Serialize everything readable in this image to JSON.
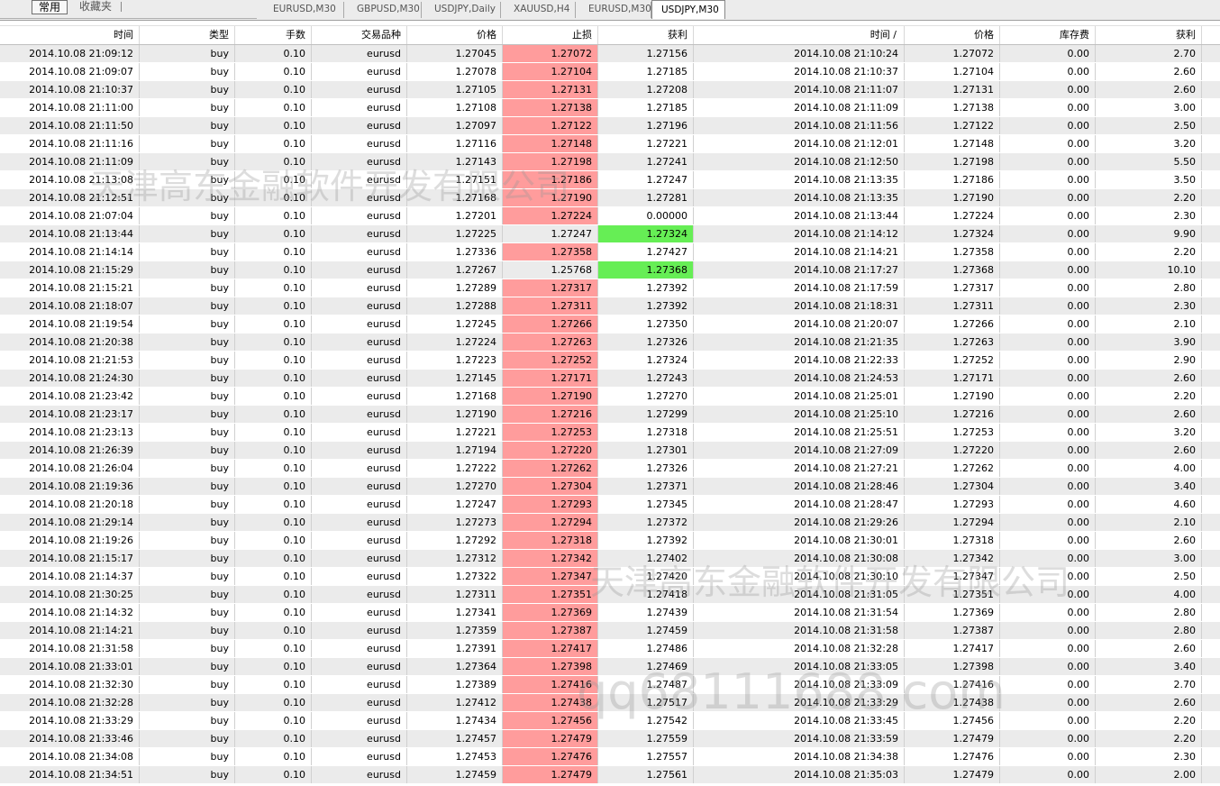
{
  "toolbar": {
    "common_label": "常用",
    "favorites_label": "收藏夹"
  },
  "tabs": [
    "EURUSD,M30",
    "GBPUSD,M30",
    "USDJPY,Daily",
    "XAUUSD,H4",
    "EURUSD,M30",
    "USDJPY,M30"
  ],
  "active_tab": 5,
  "columns": [
    "时间",
    "类型",
    "手数",
    "交易品种",
    "价格",
    "止损",
    "获利",
    "时间 /",
    "价格",
    "库存费",
    "获利"
  ],
  "colors": {
    "sl_highlight": "#ff9c9c",
    "tp_highlight": "#66ee55",
    "alt_row": "#ebebeb"
  },
  "rows": [
    [
      "2014.10.08 21:09:12",
      "buy",
      "0.10",
      "eurusd",
      "1.27045",
      "1.27072",
      "1.27156",
      "2014.10.08 21:10:24",
      "1.27072",
      "0.00",
      "2.70",
      "sl"
    ],
    [
      "2014.10.08 21:09:07",
      "buy",
      "0.10",
      "eurusd",
      "1.27078",
      "1.27104",
      "1.27185",
      "2014.10.08 21:10:37",
      "1.27104",
      "0.00",
      "2.60",
      "sl"
    ],
    [
      "2014.10.08 21:10:37",
      "buy",
      "0.10",
      "eurusd",
      "1.27105",
      "1.27131",
      "1.27208",
      "2014.10.08 21:11:07",
      "1.27131",
      "0.00",
      "2.60",
      "sl"
    ],
    [
      "2014.10.08 21:11:00",
      "buy",
      "0.10",
      "eurusd",
      "1.27108",
      "1.27138",
      "1.27185",
      "2014.10.08 21:11:09",
      "1.27138",
      "0.00",
      "3.00",
      "sl"
    ],
    [
      "2014.10.08 21:11:50",
      "buy",
      "0.10",
      "eurusd",
      "1.27097",
      "1.27122",
      "1.27196",
      "2014.10.08 21:11:56",
      "1.27122",
      "0.00",
      "2.50",
      "sl"
    ],
    [
      "2014.10.08 21:11:16",
      "buy",
      "0.10",
      "eurusd",
      "1.27116",
      "1.27148",
      "1.27221",
      "2014.10.08 21:12:01",
      "1.27148",
      "0.00",
      "3.20",
      "sl"
    ],
    [
      "2014.10.08 21:11:09",
      "buy",
      "0.10",
      "eurusd",
      "1.27143",
      "1.27198",
      "1.27241",
      "2014.10.08 21:12:50",
      "1.27198",
      "0.00",
      "5.50",
      "sl"
    ],
    [
      "2014.10.08 21:13:08",
      "buy",
      "0.10",
      "eurusd",
      "1.27151",
      "1.27186",
      "1.27247",
      "2014.10.08 21:13:35",
      "1.27186",
      "0.00",
      "3.50",
      "sl"
    ],
    [
      "2014.10.08 21:12:51",
      "buy",
      "0.10",
      "eurusd",
      "1.27168",
      "1.27190",
      "1.27281",
      "2014.10.08 21:13:35",
      "1.27190",
      "0.00",
      "2.20",
      "sl"
    ],
    [
      "2014.10.08 21:07:04",
      "buy",
      "0.10",
      "eurusd",
      "1.27201",
      "1.27224",
      "0.00000",
      "2014.10.08 21:13:44",
      "1.27224",
      "0.00",
      "2.30",
      "sl"
    ],
    [
      "2014.10.08 21:13:44",
      "buy",
      "0.10",
      "eurusd",
      "1.27225",
      "1.27247",
      "1.27324",
      "2014.10.08 21:14:12",
      "1.27324",
      "0.00",
      "9.90",
      "tp"
    ],
    [
      "2014.10.08 21:14:14",
      "buy",
      "0.10",
      "eurusd",
      "1.27336",
      "1.27358",
      "1.27427",
      "2014.10.08 21:14:21",
      "1.27358",
      "0.00",
      "2.20",
      "sl"
    ],
    [
      "2014.10.08 21:15:29",
      "buy",
      "0.10",
      "eurusd",
      "1.27267",
      "1.25768",
      "1.27368",
      "2014.10.08 21:17:27",
      "1.27368",
      "0.00",
      "10.10",
      "tp"
    ],
    [
      "2014.10.08 21:15:21",
      "buy",
      "0.10",
      "eurusd",
      "1.27289",
      "1.27317",
      "1.27392",
      "2014.10.08 21:17:59",
      "1.27317",
      "0.00",
      "2.80",
      "sl"
    ],
    [
      "2014.10.08 21:18:07",
      "buy",
      "0.10",
      "eurusd",
      "1.27288",
      "1.27311",
      "1.27392",
      "2014.10.08 21:18:31",
      "1.27311",
      "0.00",
      "2.30",
      "sl"
    ],
    [
      "2014.10.08 21:19:54",
      "buy",
      "0.10",
      "eurusd",
      "1.27245",
      "1.27266",
      "1.27350",
      "2014.10.08 21:20:07",
      "1.27266",
      "0.00",
      "2.10",
      "sl"
    ],
    [
      "2014.10.08 21:20:38",
      "buy",
      "0.10",
      "eurusd",
      "1.27224",
      "1.27263",
      "1.27326",
      "2014.10.08 21:21:35",
      "1.27263",
      "0.00",
      "3.90",
      "sl"
    ],
    [
      "2014.10.08 21:21:53",
      "buy",
      "0.10",
      "eurusd",
      "1.27223",
      "1.27252",
      "1.27324",
      "2014.10.08 21:22:33",
      "1.27252",
      "0.00",
      "2.90",
      "sl"
    ],
    [
      "2014.10.08 21:24:30",
      "buy",
      "0.10",
      "eurusd",
      "1.27145",
      "1.27171",
      "1.27243",
      "2014.10.08 21:24:53",
      "1.27171",
      "0.00",
      "2.60",
      "sl"
    ],
    [
      "2014.10.08 21:23:42",
      "buy",
      "0.10",
      "eurusd",
      "1.27168",
      "1.27190",
      "1.27270",
      "2014.10.08 21:25:01",
      "1.27190",
      "0.00",
      "2.20",
      "sl"
    ],
    [
      "2014.10.08 21:23:17",
      "buy",
      "0.10",
      "eurusd",
      "1.27190",
      "1.27216",
      "1.27299",
      "2014.10.08 21:25:10",
      "1.27216",
      "0.00",
      "2.60",
      "sl"
    ],
    [
      "2014.10.08 21:23:13",
      "buy",
      "0.10",
      "eurusd",
      "1.27221",
      "1.27253",
      "1.27318",
      "2014.10.08 21:25:51",
      "1.27253",
      "0.00",
      "3.20",
      "sl"
    ],
    [
      "2014.10.08 21:26:39",
      "buy",
      "0.10",
      "eurusd",
      "1.27194",
      "1.27220",
      "1.27301",
      "2014.10.08 21:27:09",
      "1.27220",
      "0.00",
      "2.60",
      "sl"
    ],
    [
      "2014.10.08 21:26:04",
      "buy",
      "0.10",
      "eurusd",
      "1.27222",
      "1.27262",
      "1.27326",
      "2014.10.08 21:27:21",
      "1.27262",
      "0.00",
      "4.00",
      "sl"
    ],
    [
      "2014.10.08 21:19:36",
      "buy",
      "0.10",
      "eurusd",
      "1.27270",
      "1.27304",
      "1.27371",
      "2014.10.08 21:28:46",
      "1.27304",
      "0.00",
      "3.40",
      "sl"
    ],
    [
      "2014.10.08 21:20:18",
      "buy",
      "0.10",
      "eurusd",
      "1.27247",
      "1.27293",
      "1.27345",
      "2014.10.08 21:28:47",
      "1.27293",
      "0.00",
      "4.60",
      "sl"
    ],
    [
      "2014.10.08 21:29:14",
      "buy",
      "0.10",
      "eurusd",
      "1.27273",
      "1.27294",
      "1.27372",
      "2014.10.08 21:29:26",
      "1.27294",
      "0.00",
      "2.10",
      "sl"
    ],
    [
      "2014.10.08 21:19:26",
      "buy",
      "0.10",
      "eurusd",
      "1.27292",
      "1.27318",
      "1.27392",
      "2014.10.08 21:30:01",
      "1.27318",
      "0.00",
      "2.60",
      "sl"
    ],
    [
      "2014.10.08 21:15:17",
      "buy",
      "0.10",
      "eurusd",
      "1.27312",
      "1.27342",
      "1.27402",
      "2014.10.08 21:30:08",
      "1.27342",
      "0.00",
      "3.00",
      "sl"
    ],
    [
      "2014.10.08 21:14:37",
      "buy",
      "0.10",
      "eurusd",
      "1.27322",
      "1.27347",
      "1.27420",
      "2014.10.08 21:30:10",
      "1.27347",
      "0.00",
      "2.50",
      "sl"
    ],
    [
      "2014.10.08 21:30:25",
      "buy",
      "0.10",
      "eurusd",
      "1.27311",
      "1.27351",
      "1.27418",
      "2014.10.08 21:31:05",
      "1.27351",
      "0.00",
      "4.00",
      "sl"
    ],
    [
      "2014.10.08 21:14:32",
      "buy",
      "0.10",
      "eurusd",
      "1.27341",
      "1.27369",
      "1.27439",
      "2014.10.08 21:31:54",
      "1.27369",
      "0.00",
      "2.80",
      "sl"
    ],
    [
      "2014.10.08 21:14:21",
      "buy",
      "0.10",
      "eurusd",
      "1.27359",
      "1.27387",
      "1.27459",
      "2014.10.08 21:31:58",
      "1.27387",
      "0.00",
      "2.80",
      "sl"
    ],
    [
      "2014.10.08 21:31:58",
      "buy",
      "0.10",
      "eurusd",
      "1.27391",
      "1.27417",
      "1.27486",
      "2014.10.08 21:32:28",
      "1.27417",
      "0.00",
      "2.60",
      "sl"
    ],
    [
      "2014.10.08 21:33:01",
      "buy",
      "0.10",
      "eurusd",
      "1.27364",
      "1.27398",
      "1.27469",
      "2014.10.08 21:33:05",
      "1.27398",
      "0.00",
      "3.40",
      "sl"
    ],
    [
      "2014.10.08 21:32:30",
      "buy",
      "0.10",
      "eurusd",
      "1.27389",
      "1.27416",
      "1.27487",
      "2014.10.08 21:33:09",
      "1.27416",
      "0.00",
      "2.70",
      "sl"
    ],
    [
      "2014.10.08 21:32:28",
      "buy",
      "0.10",
      "eurusd",
      "1.27412",
      "1.27438",
      "1.27517",
      "2014.10.08 21:33:29",
      "1.27438",
      "0.00",
      "2.60",
      "sl"
    ],
    [
      "2014.10.08 21:33:29",
      "buy",
      "0.10",
      "eurusd",
      "1.27434",
      "1.27456",
      "1.27542",
      "2014.10.08 21:33:45",
      "1.27456",
      "0.00",
      "2.20",
      "sl"
    ],
    [
      "2014.10.08 21:33:46",
      "buy",
      "0.10",
      "eurusd",
      "1.27457",
      "1.27479",
      "1.27559",
      "2014.10.08 21:33:59",
      "1.27479",
      "0.00",
      "2.20",
      "sl"
    ],
    [
      "2014.10.08 21:34:08",
      "buy",
      "0.10",
      "eurusd",
      "1.27453",
      "1.27476",
      "1.27557",
      "2014.10.08 21:34:38",
      "1.27476",
      "0.00",
      "2.30",
      "sl"
    ],
    [
      "2014.10.08 21:34:51",
      "buy",
      "0.10",
      "eurusd",
      "1.27459",
      "1.27479",
      "1.27561",
      "2014.10.08 21:35:03",
      "1.27479",
      "0.00",
      "2.00",
      "sl"
    ]
  ],
  "watermarks": [
    "天津高东金融软件开发有限公司",
    "天津高东金融软件开发有限公司",
    "qq68111688.com"
  ]
}
